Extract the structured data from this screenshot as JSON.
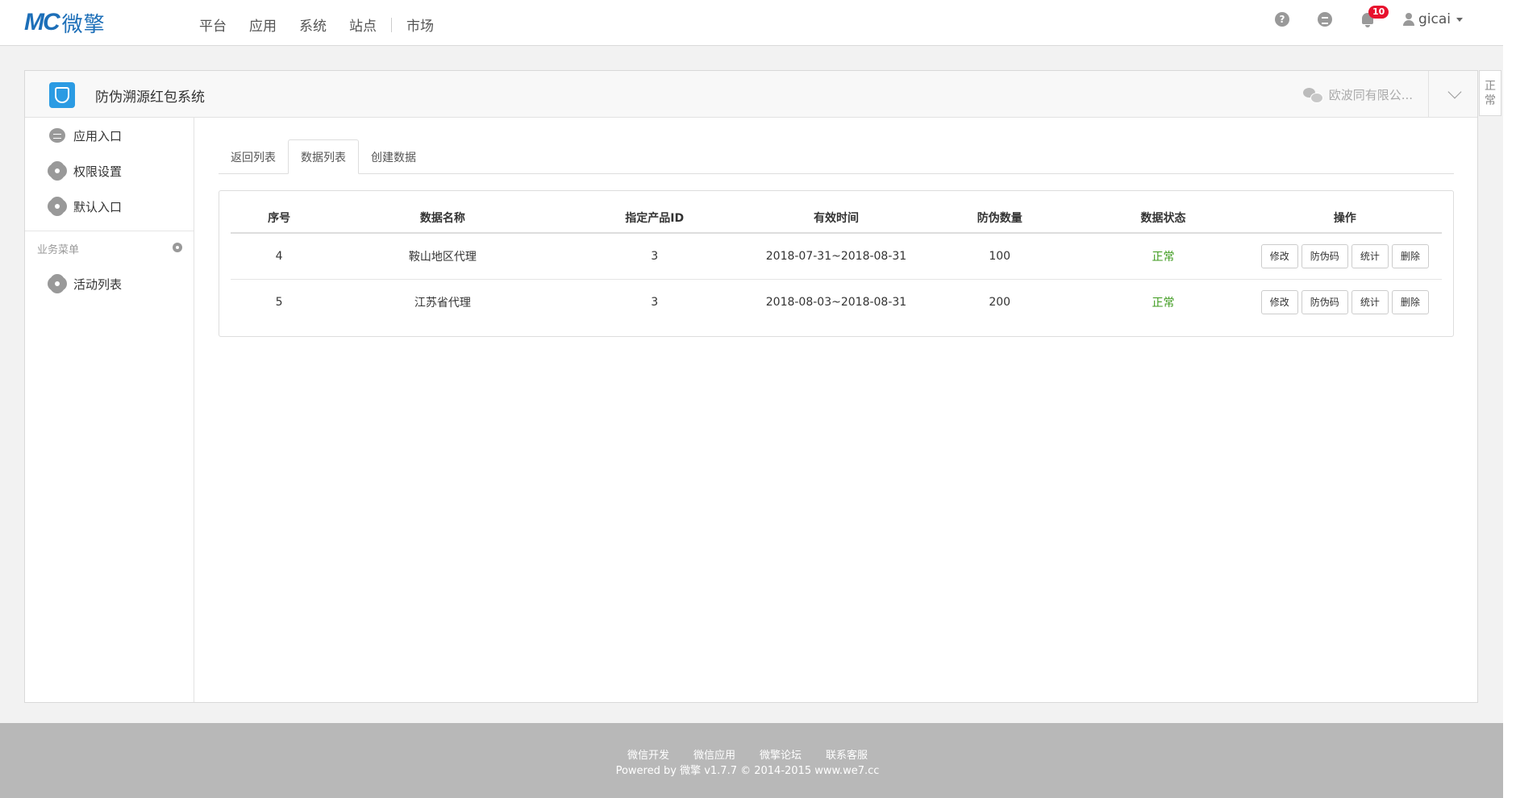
{
  "brand": {
    "mark": "MC",
    "text": "微擎"
  },
  "nav": {
    "items": [
      "平台",
      "应用",
      "系统",
      "站点",
      "市场"
    ]
  },
  "topbar": {
    "notifications_count": "10",
    "username": "gicai",
    "help_glyph": "?"
  },
  "app": {
    "title": "防伪溯源红包系统",
    "account": "欧波同有限公...",
    "side_tab": [
      "正",
      "常"
    ]
  },
  "sidebar": {
    "items": [
      {
        "label": "应用入口",
        "icon": "chat-icon"
      },
      {
        "label": "权限设置",
        "icon": "gear-icon"
      },
      {
        "label": "默认入口",
        "icon": "gear-icon"
      }
    ],
    "section_title": "业务菜单",
    "section_items": [
      {
        "label": "活动列表",
        "icon": "gear-icon"
      }
    ]
  },
  "tabs": [
    "返回列表",
    "数据列表",
    "创建数据"
  ],
  "table": {
    "headers": [
      "序号",
      "数据名称",
      "指定产品ID",
      "有效时间",
      "防伪数量",
      "数据状态",
      "操作"
    ],
    "rows": [
      {
        "id": "4",
        "name": "鞍山地区代理",
        "product_id": "3",
        "period": "2018-07-31~2018-08-31",
        "quantity": "100",
        "status": "正常"
      },
      {
        "id": "5",
        "name": "江苏省代理",
        "product_id": "3",
        "period": "2018-08-03~2018-08-31",
        "quantity": "200",
        "status": "正常"
      }
    ],
    "actions": [
      "修改",
      "防伪码",
      "统计",
      "删除"
    ]
  },
  "footer": {
    "links": [
      "微信开发",
      "微信应用",
      "微擎论坛",
      "联系客服"
    ],
    "copyright": "Powered by 微擎 v1.7.7 © 2014-2015 www.we7.cc"
  },
  "colors": {
    "brand": "#1d6fb8",
    "status_ok": "#3c9a1c",
    "badge": "#e8112d",
    "app_icon": "#2b9be3"
  }
}
